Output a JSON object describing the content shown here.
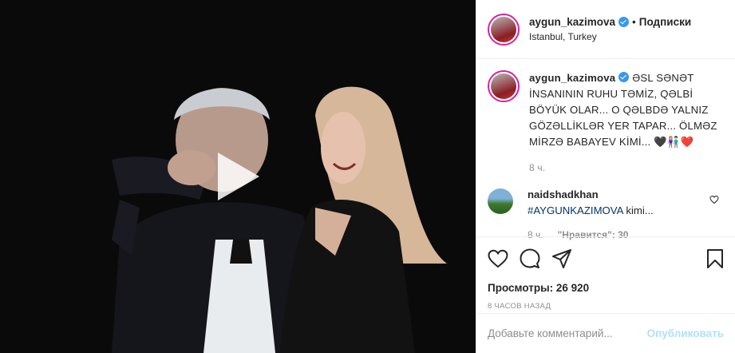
{
  "header": {
    "username": "aygun_kazimova",
    "dot": "•",
    "follow_label": "Подписки",
    "location": "Istanbul, Turkey"
  },
  "caption": {
    "username": "aygun_kazimova",
    "text": "ƏSL SƏNƏT İNSANININ RUHU TƏMİZ, QƏLBİ BÖYÜK OLAR... O QƏLBDƏ YALNIZ GÖZƏLLİKLƏR YER TAPAR... ÖLMƏZ MİRZƏ BABAYEV KİMİ... 🖤👩🏼‍🤝‍👨🏻❤️",
    "time": "8 ч."
  },
  "comment": {
    "username": "naidshadkhan",
    "hashtag": "#AYGUNKAZIMOVA",
    "text": " kimi...",
    "time": "8 ч.",
    "likes": "\"Нравится\": 30"
  },
  "stats": {
    "views": "Просмотры: 26 920",
    "ago": "8 ЧАСОВ НАЗАД"
  },
  "add_comment": {
    "placeholder": "Добавьте комментарий...",
    "post_label": "Опубликовать"
  },
  "colors": {
    "verified": "#3897f0",
    "post_disabled": "#b2dffc",
    "hashtag": "#003569",
    "muted": "#8e8e8e"
  },
  "icons": [
    "play-icon",
    "verified-icon",
    "heart-icon",
    "comment-icon",
    "share-icon",
    "bookmark-icon",
    "small-heart-icon"
  ]
}
